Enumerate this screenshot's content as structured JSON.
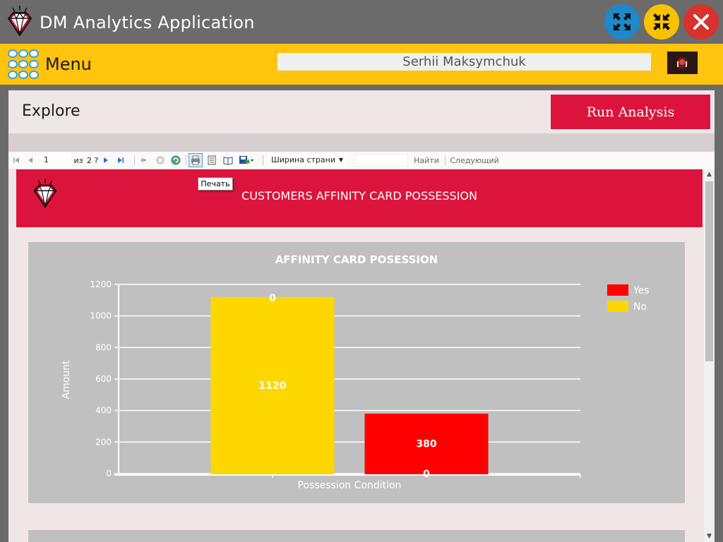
{
  "app": {
    "title": "DM Analytics Application"
  },
  "window_controls": {
    "maximize": "expand-icon",
    "minimize": "compress-icon",
    "close": "close-icon"
  },
  "menubar": {
    "label": "Menu",
    "user_name": "Serhii Maksymchuk"
  },
  "explore": {
    "title": "Explore",
    "run_button": "Run Analysis"
  },
  "toolbar": {
    "page_current": "1",
    "page_of": "из",
    "page_total": "2 ?",
    "zoom_value": "Ширина страни",
    "find_label": "Найти",
    "next_label": "Следующий",
    "tooltip": "Печать"
  },
  "report": {
    "title": "CUSTOMERS AFFINITY CARD POSSESSION"
  },
  "colors": {
    "accent_red": "#dc143c",
    "menu_yellow": "#ffc40d",
    "bar_yes": "#ff0000",
    "bar_no": "#ffd700"
  },
  "chart_data": {
    "type": "bar",
    "title": "AFFINITY CARD POSESSION",
    "xlabel": "Possession Condition",
    "ylabel": "Amount",
    "ylim": [
      0,
      1200
    ],
    "yticks": [
      0,
      200,
      400,
      600,
      800,
      1000,
      1200
    ],
    "legend_position": "top-right",
    "series": [
      {
        "name": "No",
        "color": "#ffd700",
        "values": [
          1120,
          0
        ]
      },
      {
        "name": "Yes",
        "color": "#ff0000",
        "values": [
          0,
          380
        ]
      }
    ]
  }
}
